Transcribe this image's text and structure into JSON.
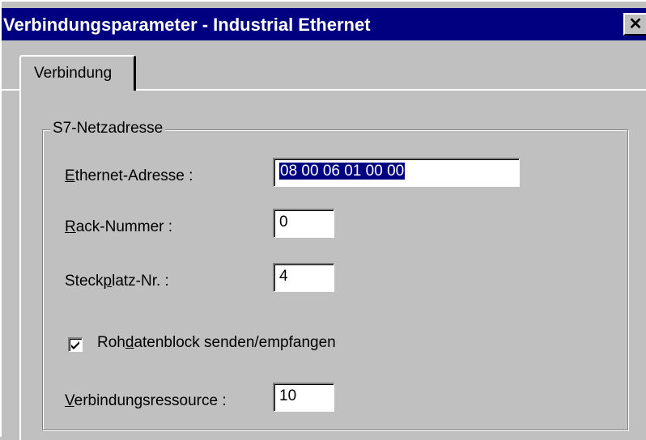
{
  "window": {
    "title": "Verbindungsparameter - Industrial Ethernet",
    "close_glyph": "✕"
  },
  "tabs": [
    {
      "label": "Verbindung",
      "active": true
    }
  ],
  "group": {
    "label": "S7-Netzadresse"
  },
  "fields": {
    "ethernet": {
      "label_pre": "",
      "label_mnemonic": "E",
      "label_post": "thernet-Adresse :",
      "value": "08 00 06 01 00 00",
      "selected": true
    },
    "rack": {
      "label_pre": "",
      "label_mnemonic": "R",
      "label_post": "ack-Nummer :",
      "value": "0"
    },
    "slot": {
      "label_pre": "Steck",
      "label_mnemonic": "p",
      "label_post": "latz-Nr. :",
      "value": "4"
    },
    "rawdata": {
      "label_pre": "Roh",
      "label_mnemonic": "d",
      "label_post": "atenblock senden/empfangen",
      "checked": true
    },
    "resource": {
      "label_pre": "",
      "label_mnemonic": "V",
      "label_post": "erbindungsressource :",
      "value": "10"
    }
  },
  "colors": {
    "titlebar": "#000080",
    "face": "#c0c0c0",
    "selection": "#000080"
  }
}
